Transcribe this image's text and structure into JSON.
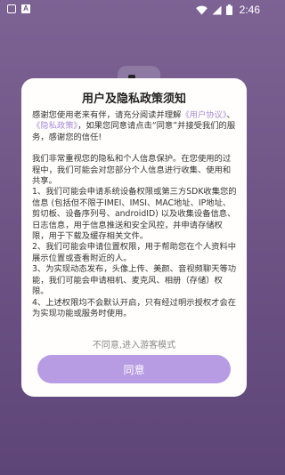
{
  "status_bar": {
    "time": "2:46",
    "icons": [
      "notification-box-icon",
      "app-a-icon",
      "wifi-icon",
      "signal-icon",
      "battery-icon"
    ],
    "app_badge": "A"
  },
  "dialog": {
    "title": "用户及隐私政策须知",
    "intro": {
      "text1": "感谢您使用老来有伴，请充分阅读并理解",
      "link1": "《用户协议》",
      "sep": "、",
      "link2": "《隐私政策》",
      "text2": "，如果您同意请点击“同意”并接受我们的服务，感谢您的信任!"
    },
    "paragraph2": "我们非常重视您的隐私和个人信息保护。在您使用的过程中，我们可能会对您部分个人信息进行收集、使用和共享。",
    "items": [
      "1、我们可能会申请系统设备权限或第三方SDK收集您的信息 (包括但不限于IMEI、IMSI、MAC地址、IP地址、剪切板、设备序列号、androidID) 以及收集设备信息、日志信息，用于信息推送和安全风控，并申请存储权限，用于下载及缓存相关文件。",
      "2、我们可能会申请位置权限，用于帮助您在个人资料中展示位置或查看附近的人。",
      "3、为实现动态发布，头像上传、美颜、音视频聊天等功能，我们可能会申请相机、麦克风、相册（存储）权限。",
      "4、上述权限均不会默认开启，只有经过明示授权才会在为实现功能或服务时使用。"
    ],
    "disagree_label": "不同意,进入游客模式",
    "agree_label": "同意"
  },
  "colors": {
    "accent": "#b79be3",
    "link": "#a88bd6",
    "background": "#6f5586"
  }
}
